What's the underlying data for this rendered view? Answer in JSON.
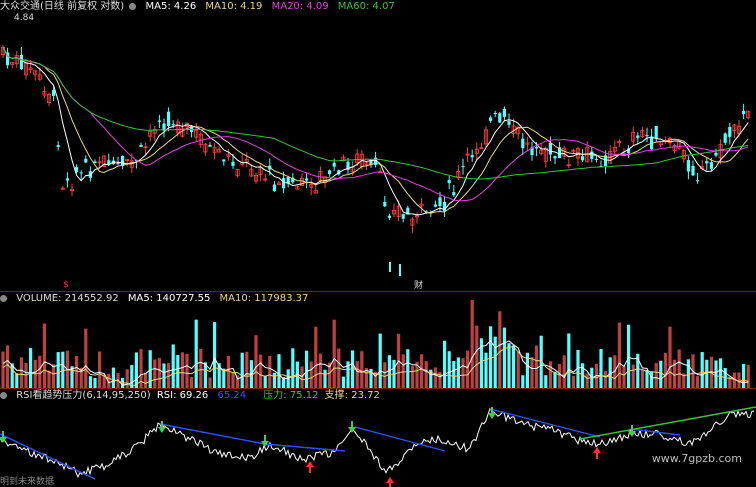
{
  "main": {
    "title": "大众交通(日线 前复权 对数)",
    "ma5": "MA5: 4.26",
    "ma10": "MA10: 4.19",
    "ma20": "MA20: 4.09",
    "ma60": "MA60: 4.07",
    "top_price": "4.84",
    "cai_label": "财",
    "dollar": "$"
  },
  "volume": {
    "title": "VOLUME: 214552.92",
    "ma5": "MA5: 140727.55",
    "ma10": "MA10: 117983.37"
  },
  "rsi": {
    "title": "RSI看趋势压力(6,14,95,250)",
    "rsi": "RSI: 69.26",
    "v2": "65.24",
    "pressure": "压力: 75.12",
    "support": "支撑: 23.72"
  },
  "footer": {
    "bottom_label": "明到未来数据",
    "watermark": "www.7gpzb.com"
  },
  "colors": {
    "up": "#ff4040",
    "down": "#54ffff",
    "ma5": "#ffffff",
    "ma10": "#e8d880",
    "ma20": "#e040e0",
    "ma60": "#40c040",
    "rsi_line": "#ffffff",
    "trend_blue": "#3050ff",
    "trend_green": "#40c040",
    "arrow_red": "#ff3030",
    "arrow_green": "#40d040"
  }
}
